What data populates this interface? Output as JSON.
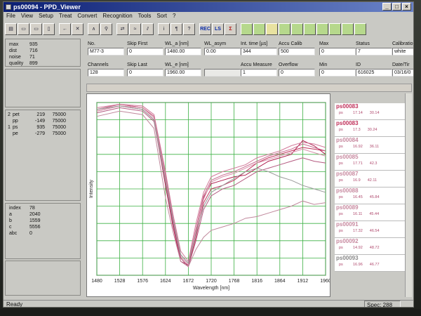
{
  "window": {
    "title": "ps00094 - PPD_Viewer"
  },
  "window_buttons": [
    "_",
    "□",
    "×"
  ],
  "menu": [
    "File",
    "View",
    "Setup",
    "Treat",
    "Convert",
    "Recognition",
    "Tools",
    "Sort",
    "?"
  ],
  "toolbar": {
    "buttons": [
      {
        "icon": "disk-icon",
        "glyph": "▤"
      },
      {
        "icon": "folder-open-icon",
        "glyph": "▭"
      },
      {
        "icon": "folder-icon",
        "glyph": "▭"
      },
      {
        "icon": "book-icon",
        "glyph": "▯"
      },
      {
        "icon": "arrow-left-icon",
        "glyph": "←"
      },
      {
        "icon": "cross-icon",
        "glyph": "✕"
      },
      {
        "icon": "spectrum-icon",
        "glyph": "∧"
      },
      {
        "icon": "zoom-icon",
        "glyph": "⚲"
      },
      {
        "icon": "compare-icon",
        "glyph": "⇄"
      },
      {
        "icon": "overlay-icon",
        "glyph": "≈"
      },
      {
        "icon": "split-icon",
        "glyph": "⫽"
      },
      {
        "icon": "info-icon",
        "glyph": "i"
      },
      {
        "icon": "pin-icon",
        "glyph": "¶"
      },
      {
        "icon": "help-pointer-icon",
        "glyph": "?"
      },
      {
        "icon": "rec-icon",
        "glyph": "REC"
      },
      {
        "icon": "ls-icon",
        "glyph": "LS"
      },
      {
        "icon": "sigma-icon",
        "glyph": "Σ"
      },
      {
        "icon": "slot-1-icon",
        "glyph": ""
      },
      {
        "icon": "slot-2-icon",
        "glyph": ""
      },
      {
        "icon": "slot-3-icon",
        "glyph": ""
      },
      {
        "icon": "slot-4-icon",
        "glyph": ""
      },
      {
        "icon": "slot-5-icon",
        "glyph": ""
      },
      {
        "icon": "slot-6-icon",
        "glyph": ""
      },
      {
        "icon": "slot-7-icon",
        "glyph": ""
      },
      {
        "icon": "slot-8-icon",
        "glyph": ""
      },
      {
        "icon": "slot-9-icon",
        "glyph": ""
      },
      {
        "icon": "slot-10-icon",
        "glyph": ""
      }
    ]
  },
  "stats": [
    {
      "k": "max",
      "v": "935"
    },
    {
      "k": "dist",
      "v": "716"
    },
    {
      "k": "noise",
      "v": "71"
    },
    {
      "k": "quality",
      "v": "899"
    }
  ],
  "peaks": [
    {
      "n": "2",
      "type": "pet",
      "a": "219",
      "b": "75000"
    },
    {
      "n": "",
      "type": "pp",
      "a": "-149",
      "b": "75000"
    },
    {
      "n": "1",
      "type": "ps",
      "a": "935",
      "b": "75000"
    },
    {
      "n": "",
      "type": "pe",
      "a": "-279",
      "b": "75000"
    }
  ],
  "indices": [
    {
      "k": "index",
      "v": "78"
    },
    {
      "k": "a",
      "v": "2040"
    },
    {
      "k": "b",
      "v": "1559"
    },
    {
      "k": "c",
      "v": "5556"
    },
    {
      "k": "abc",
      "v": "0"
    }
  ],
  "fields_row1": [
    {
      "label": "No.",
      "value": "M77-3"
    },
    {
      "label": "Skip First",
      "value": "0"
    },
    {
      "label": "WL_a [nm]",
      "value": "1480.00"
    },
    {
      "label": "WL_asym",
      "value": "0.00"
    },
    {
      "label": "Int. time [µs]",
      "value": "344"
    },
    {
      "label": "Accu Calib",
      "value": "500"
    },
    {
      "label": "Max",
      "value": "0"
    },
    {
      "label": "Status",
      "value": "7"
    },
    {
      "label": "Calibratio",
      "value": "white"
    }
  ],
  "fields_row2": [
    {
      "label": "Channels",
      "value": "128"
    },
    {
      "label": "Skip Last",
      "value": "0"
    },
    {
      "label": "WL_e [nm]",
      "value": "1960.00"
    },
    {
      "label": "",
      "value": ""
    },
    {
      "label": "Accu Measure",
      "value": "1"
    },
    {
      "label": "Overflow",
      "value": "0"
    },
    {
      "label": "Min",
      "value": "0"
    },
    {
      "label": "ID",
      "value": "616025"
    },
    {
      "label": "Date/Tir",
      "value": "03/16/0"
    }
  ],
  "spectra": [
    {
      "name": "ps00083",
      "color": "#c0305a",
      "s1": "ps",
      "s2": "17.14",
      "s3": "30.14"
    },
    {
      "name": "ps00083",
      "color": "#c0305a",
      "s1": "ps",
      "s2": "17.3",
      "s3": "30.24"
    },
    {
      "name": "ps00084",
      "color": "#c88aa0",
      "s1": "ps",
      "s2": "16.92",
      "s3": "36.11"
    },
    {
      "name": "ps00085",
      "color": "#c88aa0",
      "s1": "ps",
      "s2": "17.71",
      "s3": "42.3"
    },
    {
      "name": "ps00087",
      "color": "#c88aa0",
      "s1": "ps",
      "s2": "16.9",
      "s3": "42.11"
    },
    {
      "name": "ps00088",
      "color": "#c88aa0",
      "s1": "ps",
      "s2": "16.45",
      "s3": "45.84"
    },
    {
      "name": "ps00089",
      "color": "#c88aa0",
      "s1": "ps",
      "s2": "16.11",
      "s3": "45.44"
    },
    {
      "name": "ps00091",
      "color": "#c88aa0",
      "s1": "ps",
      "s2": "17.32",
      "s3": "46.54"
    },
    {
      "name": "ps00092",
      "color": "#c88aa0",
      "s1": "ps",
      "s2": "14.92",
      "s3": "48.72"
    },
    {
      "name": "ps00093",
      "color": "#888888",
      "s1": "ps",
      "s2": "16.96",
      "s3": "46.77"
    }
  ],
  "status": {
    "left": "Ready",
    "right": "Spec: 288"
  },
  "chart_data": {
    "type": "line",
    "xlabel": "Wavelength [nm]",
    "ylabel": "Intensity",
    "xlim": [
      1480,
      1960
    ],
    "x_ticks": [
      "1480",
      "1528",
      "1576",
      "1624",
      "1672",
      "1720",
      "1768",
      "1816",
      "1864",
      "1912",
      "1960"
    ],
    "grid": true,
    "x": [
      1480,
      1528,
      1576,
      1600,
      1624,
      1640,
      1656,
      1672,
      1688,
      1704,
      1720,
      1744,
      1768,
      1792,
      1816,
      1840,
      1864,
      1888,
      1912,
      1936,
      1960
    ],
    "series": [
      {
        "color": "#c0305a",
        "values": [
          0.96,
          0.99,
          0.97,
          0.92,
          0.55,
          0.3,
          0.1,
          0.05,
          0.22,
          0.42,
          0.5,
          0.52,
          0.55,
          0.6,
          0.65,
          0.68,
          0.7,
          0.72,
          0.74,
          0.73,
          0.72
        ]
      },
      {
        "color": "#b02050",
        "values": [
          0.95,
          0.98,
          0.96,
          0.9,
          0.52,
          0.28,
          0.08,
          0.06,
          0.25,
          0.45,
          0.53,
          0.55,
          0.57,
          0.58,
          0.62,
          0.66,
          0.68,
          0.7,
          0.78,
          0.75,
          0.7
        ]
      },
      {
        "color": "#d27a9a",
        "values": [
          0.97,
          0.99,
          0.98,
          0.93,
          0.6,
          0.35,
          0.14,
          0.08,
          0.3,
          0.48,
          0.57,
          0.6,
          0.62,
          0.64,
          0.68,
          0.7,
          0.72,
          0.75,
          0.77,
          0.76,
          0.74
        ]
      },
      {
        "color": "#c86b8e",
        "values": [
          0.96,
          0.99,
          0.97,
          0.92,
          0.58,
          0.33,
          0.12,
          0.07,
          0.27,
          0.46,
          0.55,
          0.58,
          0.6,
          0.63,
          0.66,
          0.69,
          0.71,
          0.73,
          0.76,
          0.74,
          0.72
        ]
      },
      {
        "color": "#d890aa",
        "values": [
          0.95,
          0.98,
          0.97,
          0.91,
          0.56,
          0.31,
          0.11,
          0.06,
          0.26,
          0.44,
          0.54,
          0.57,
          0.59,
          0.62,
          0.65,
          0.67,
          0.69,
          0.71,
          0.73,
          0.71,
          0.69
        ]
      },
      {
        "color": "#b45a80",
        "values": [
          0.94,
          0.97,
          0.95,
          0.89,
          0.54,
          0.3,
          0.1,
          0.05,
          0.2,
          0.38,
          0.46,
          0.5,
          0.52,
          0.56,
          0.6,
          0.62,
          0.64,
          0.66,
          0.68,
          0.66,
          0.65
        ]
      },
      {
        "color": "#9a9a9a",
        "values": [
          0.96,
          0.98,
          0.96,
          0.9,
          0.55,
          0.32,
          0.12,
          0.07,
          0.24,
          0.4,
          0.48,
          0.52,
          0.56,
          0.6,
          0.62,
          0.6,
          0.57,
          0.55,
          0.52,
          0.5,
          0.48
        ]
      },
      {
        "color": "#c0889c",
        "values": [
          0.92,
          0.95,
          0.93,
          0.85,
          0.45,
          0.25,
          0.08,
          0.05,
          0.15,
          0.22,
          0.26,
          0.28,
          0.3,
          0.33,
          0.34,
          0.36,
          0.38,
          0.4,
          0.43,
          0.41,
          0.42
        ]
      }
    ]
  }
}
